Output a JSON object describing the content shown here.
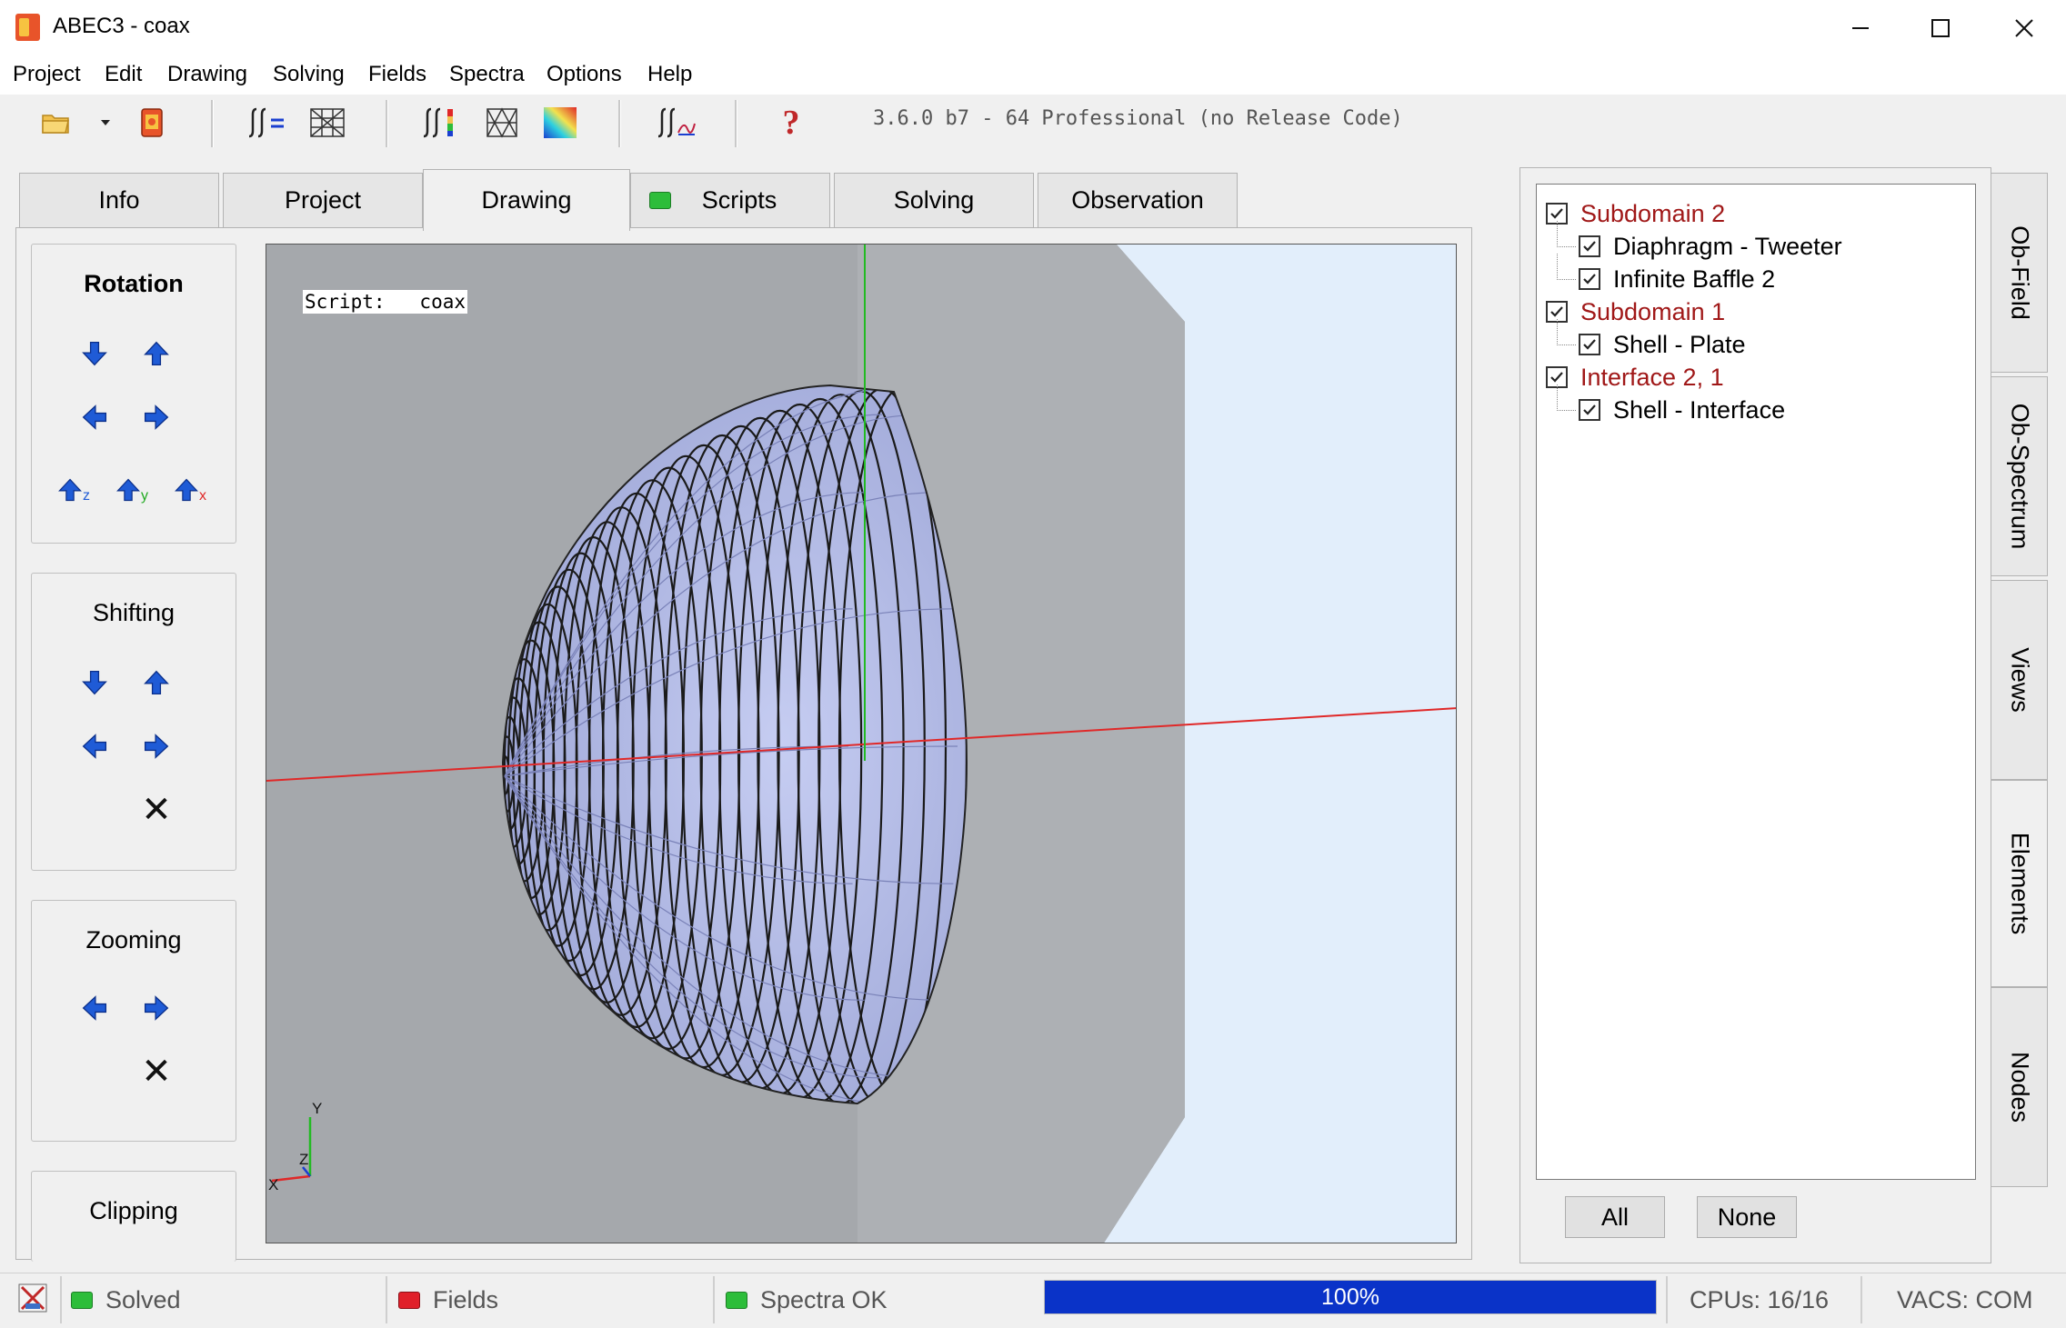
{
  "window": {
    "title": "ABEC3 - coax",
    "minimize": "—",
    "maximize": "☐",
    "close": "✕"
  },
  "menu": [
    "Project",
    "Edit",
    "Drawing",
    "Solving",
    "Fields",
    "Spectra",
    "Options",
    "Help"
  ],
  "toolbar": {
    "icons": [
      "open-folder-icon",
      "dropdown-arrow-icon",
      "project-book-icon",
      "integral-equation-icon",
      "mesh-grid-icon",
      "integral-color-icon",
      "mesh-triangle-icon",
      "color-map-icon",
      "integral-curve-icon",
      "help-icon"
    ],
    "help_glyph": "?",
    "version": "3.6.0 b7 - 64 Professional (no Release Code)"
  },
  "tabs": [
    {
      "label": "Info",
      "active": false
    },
    {
      "label": "Project",
      "active": false
    },
    {
      "label": "Drawing",
      "active": true
    },
    {
      "label": "Scripts",
      "active": false,
      "led": "#2dbd3a"
    },
    {
      "label": "Solving",
      "active": false
    },
    {
      "label": "Observation",
      "active": false
    }
  ],
  "controls": {
    "rotation": {
      "title": "Rotation",
      "axis_z": "z",
      "axis_y": "y",
      "axis_x": "x"
    },
    "shifting": {
      "title": "Shifting",
      "reset": "✕"
    },
    "zooming": {
      "title": "Zooming",
      "reset": "✕"
    },
    "clipping": {
      "title": "Clipping"
    }
  },
  "viewport": {
    "script_label": "Script:   coax",
    "axis_labels": {
      "y": "Y",
      "z": "Z",
      "x": "X"
    }
  },
  "elements_tree": [
    {
      "label": "Subdomain 2",
      "level": 0,
      "checked": true
    },
    {
      "label": "Diaphragm - Tweeter",
      "level": 1,
      "checked": true
    },
    {
      "label": "Infinite Baffle 2",
      "level": 1,
      "checked": true
    },
    {
      "label": "Subdomain 1",
      "level": 0,
      "checked": true
    },
    {
      "label": "Shell - Plate",
      "level": 1,
      "checked": true
    },
    {
      "label": "Interface 2, 1",
      "level": 0,
      "checked": true
    },
    {
      "label": "Shell - Interface",
      "level": 1,
      "checked": true
    }
  ],
  "tree_buttons": {
    "all": "All",
    "none": "None"
  },
  "side_tabs": [
    {
      "label": "Ob-Field",
      "active": false
    },
    {
      "label": "Ob-Spectrum",
      "active": false
    },
    {
      "label": "Views",
      "active": false
    },
    {
      "label": "Elements",
      "active": true
    },
    {
      "label": "Nodes",
      "active": false
    }
  ],
  "status": {
    "solved": {
      "label": "Solved",
      "color": "#2dbd3a"
    },
    "fields": {
      "label": "Fields",
      "color": "#e0202a"
    },
    "spectra": {
      "label": "Spectra OK",
      "color": "#2dbd3a"
    },
    "progress": {
      "text": "100%",
      "percent": 100
    },
    "cpus": "CPUs: 16/16",
    "vacs": "VACS: COM"
  },
  "colors": {
    "accent_red": "#a01818",
    "progress_blue": "#0a33c8",
    "mesh_fill": "#b3bbe6",
    "x_axis": "#e02828",
    "y_axis": "#22bb22"
  }
}
